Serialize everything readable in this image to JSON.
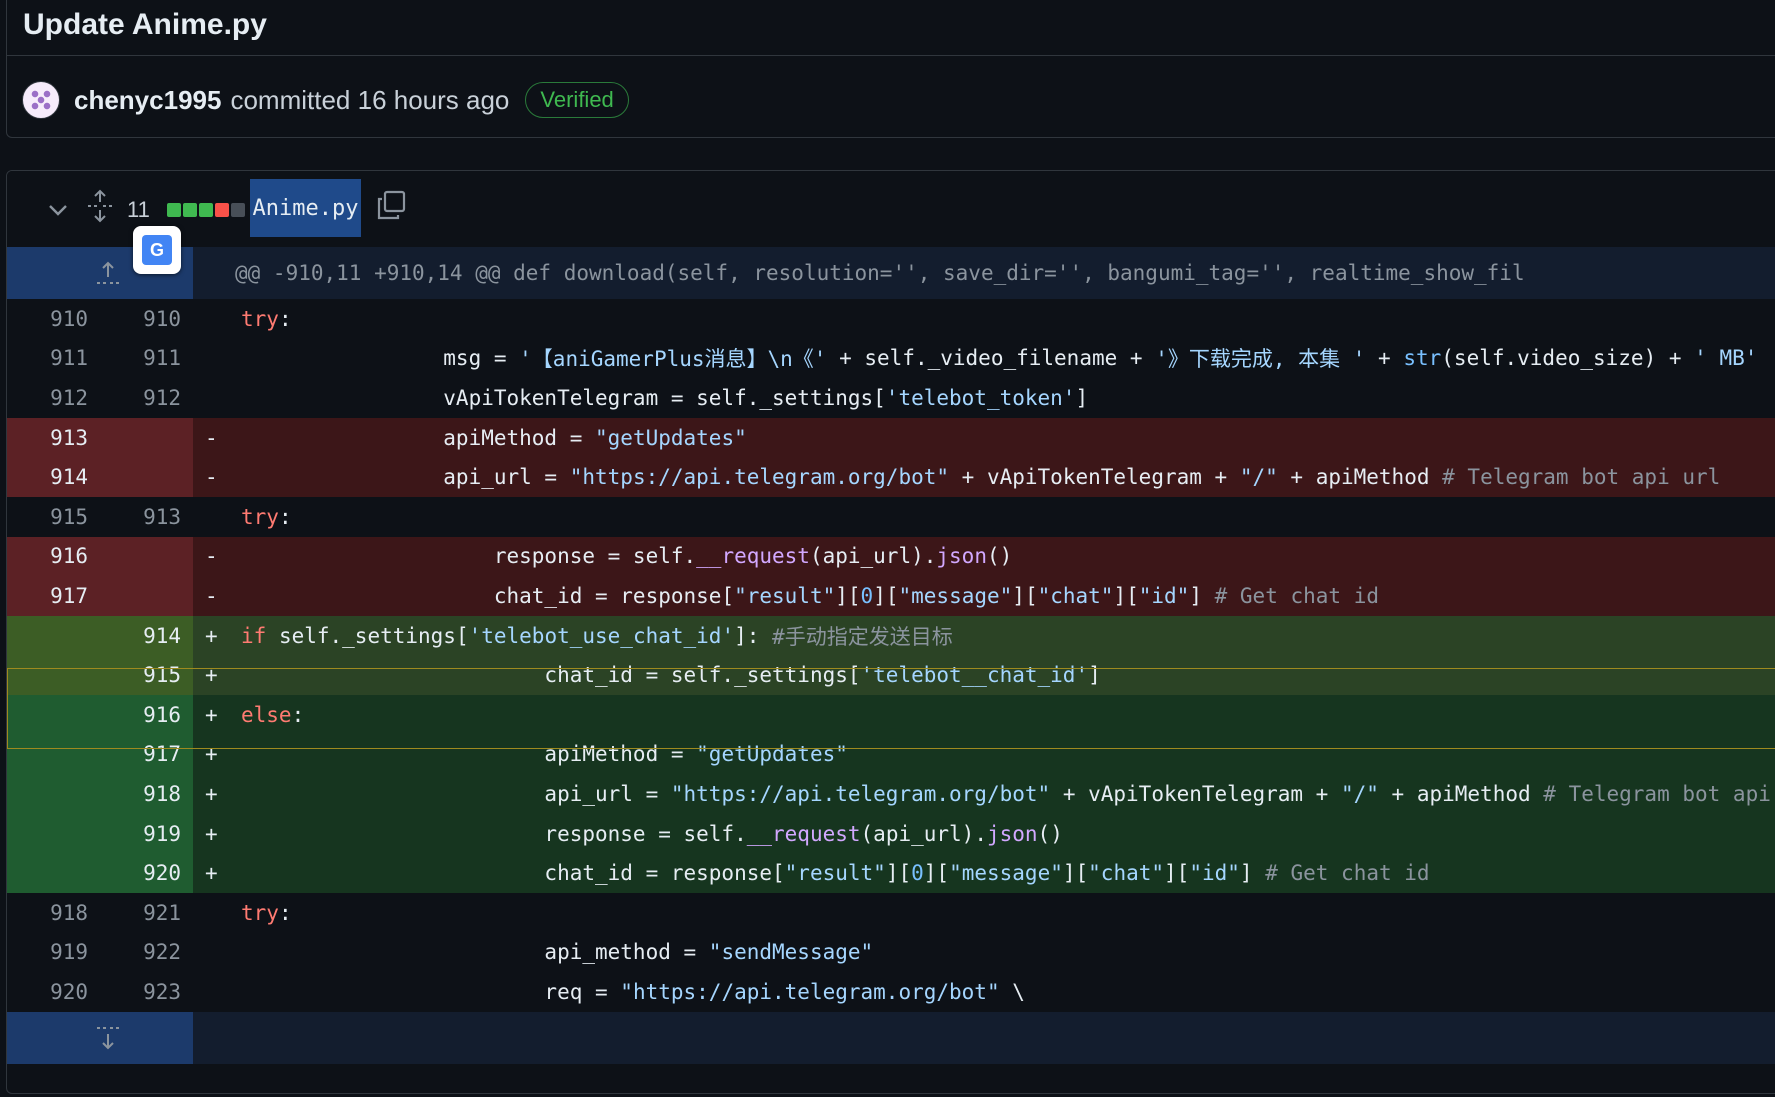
{
  "commit": {
    "title": "Update Anime.py",
    "author": "chenyc1995",
    "action": "committed",
    "time": "16 hours ago",
    "badge": "Verified"
  },
  "file": {
    "change_count": "11",
    "diffstat": [
      "green",
      "green",
      "green",
      "red",
      "gray"
    ],
    "name": "Anime.py"
  },
  "hunk_header": "@@ -910,11 +910,14 @@ def download(self, resolution='', save_dir='', bangumi_tag='', realtime_show_fil",
  "lines": [
    {
      "type": "ctx",
      "old": "910",
      "new": "910",
      "marker": "",
      "code": "            try:"
    },
    {
      "type": "ctx",
      "old": "911",
      "new": "911",
      "marker": "",
      "code": "                msg = '【aniGamerPlus消息】\\n《' + self._video_filename + '》下载完成, 本集 ' + str(self.video_size) + ' MB'"
    },
    {
      "type": "ctx",
      "old": "912",
      "new": "912",
      "marker": "",
      "code": "                vApiTokenTelegram = self._settings['telebot_token']"
    },
    {
      "type": "del",
      "old": "913",
      "new": "",
      "marker": "-",
      "code": "                apiMethod = \"getUpdates\""
    },
    {
      "type": "del",
      "old": "914",
      "new": "",
      "marker": "-",
      "code": "                api_url = \"https://api.telegram.org/bot\" + vApiTokenTelegram + \"/\" + apiMethod # Telegram bot api url"
    },
    {
      "type": "ctx",
      "old": "915",
      "new": "913",
      "marker": "",
      "code": "                try:"
    },
    {
      "type": "del",
      "old": "916",
      "new": "",
      "marker": "-",
      "code": "                    response = self.__request(api_url).json()"
    },
    {
      "type": "del",
      "old": "917",
      "new": "",
      "marker": "-",
      "code": "                    chat_id = response[\"result\"][0][\"message\"][\"chat\"][\"id\"] # Get chat id"
    },
    {
      "type": "add",
      "hl": true,
      "old": "",
      "new": "914",
      "marker": "+",
      "code": "                    if self._settings['telebot_use_chat_id']: #手动指定发送目标"
    },
    {
      "type": "add",
      "hl": true,
      "old": "",
      "new": "915",
      "marker": "+",
      "code": "                        chat_id = self._settings['telebot__chat_id']"
    },
    {
      "type": "add",
      "old": "",
      "new": "916",
      "marker": "+",
      "code": "                    else:"
    },
    {
      "type": "add",
      "old": "",
      "new": "917",
      "marker": "+",
      "code": "                        apiMethod = \"getUpdates\""
    },
    {
      "type": "add",
      "old": "",
      "new": "918",
      "marker": "+",
      "code": "                        api_url = \"https://api.telegram.org/bot\" + vApiTokenTelegram + \"/\" + apiMethod # Telegram bot api url"
    },
    {
      "type": "add",
      "old": "",
      "new": "919",
      "marker": "+",
      "code": "                        response = self.__request(api_url).json()"
    },
    {
      "type": "add",
      "old": "",
      "new": "920",
      "marker": "+",
      "code": "                        chat_id = response[\"result\"][0][\"message\"][\"chat\"][\"id\"] # Get chat id"
    },
    {
      "type": "ctx",
      "old": "918",
      "new": "921",
      "marker": "",
      "code": "                    try:"
    },
    {
      "type": "ctx",
      "old": "919",
      "new": "922",
      "marker": "",
      "code": "                        api_method = \"sendMessage\""
    },
    {
      "type": "ctx",
      "old": "920",
      "new": "923",
      "marker": "",
      "code": "                        req = \"https://api.telegram.org/bot\" \\"
    }
  ],
  "colors": {
    "deleted_bg": "#3c1618",
    "added_bg": "#16351f",
    "highlight_border": "#9e8a1f",
    "accent": "#1f4a8a",
    "verified": "#3fb950"
  },
  "icons": {
    "collapse": "chevron-down-icon",
    "expand_all": "unfold-icon",
    "copy": "copy-icon",
    "translate": "google-translate-icon",
    "hunk_expand_up": "expand-up-icon",
    "hunk_expand_down": "expand-down-icon"
  }
}
